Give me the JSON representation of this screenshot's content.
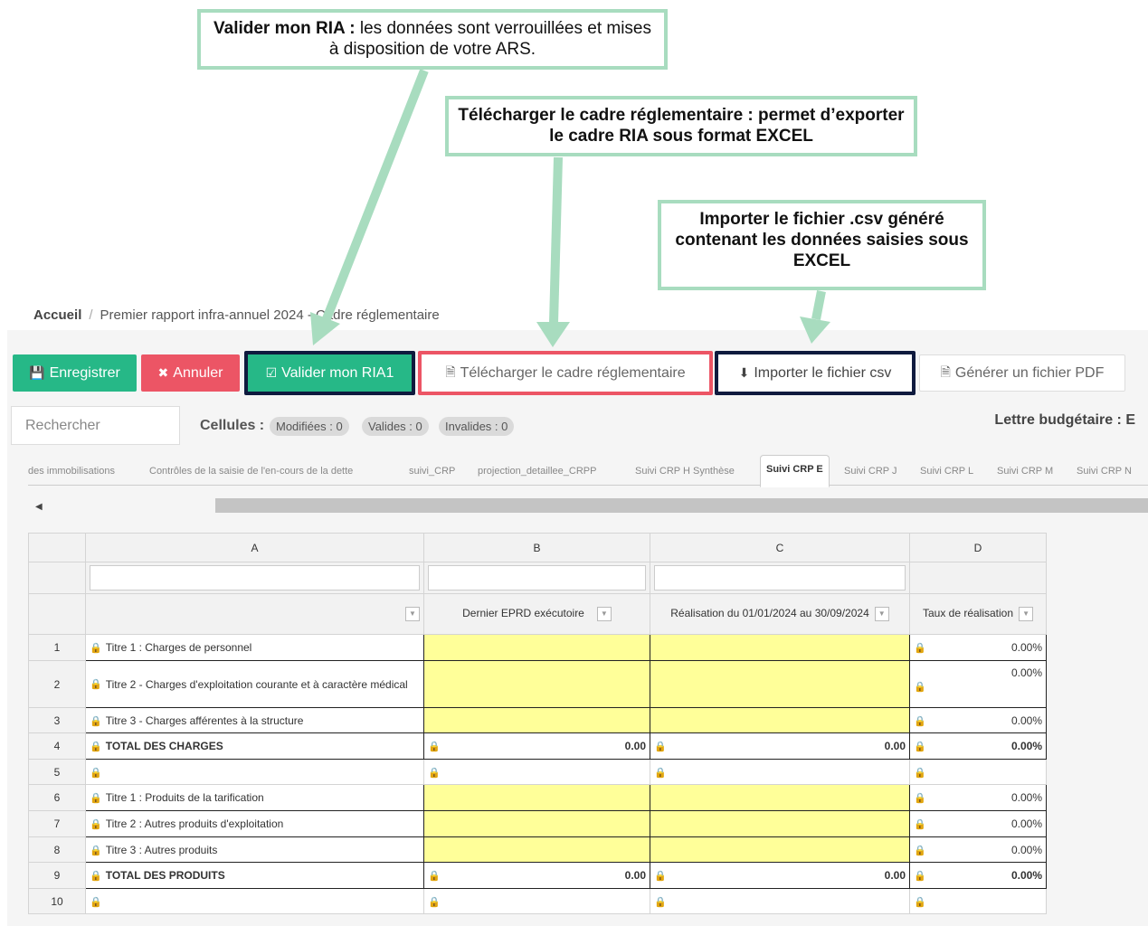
{
  "callouts": {
    "valider": {
      "bold": "Valider mon RIA :",
      "text": " les données sont verrouillées et mises à disposition de votre ARS."
    },
    "telecharger": "Télécharger le cadre réglementaire : permet d’exporter le cadre RIA sous format EXCEL",
    "importer": "Importer le fichier .csv généré contenant les données saisies sous EXCEL"
  },
  "breadcrumb": {
    "home": "Accueil",
    "separator": "/",
    "current": "Premier rapport infra-annuel 2024 - Cadre réglementaire"
  },
  "toolbar": {
    "save": "Enregistrer",
    "cancel": "Annuler",
    "validate": "Valider mon RIA1",
    "download": "Télécharger le cadre réglementaire",
    "import": "Importer le fichier csv",
    "pdf": "Générer un fichier PDF"
  },
  "search": {
    "placeholder": "Rechercher"
  },
  "cells": {
    "label": "Cellules :",
    "modified": "Modifiées : 0",
    "valid": "Valides : 0",
    "invalid": "Invalides : 0"
  },
  "lettre": "Lettre budgétaire : E",
  "tabs": [
    "des immobilisations",
    "Contrôles de la saisie de l'en-cours de la dette",
    "suivi_CRP",
    "projection_detaillee_CRPP",
    "Suivi CRP H Synthèse",
    "Suivi CRP E",
    "Suivi CRP J",
    "Suivi CRP L",
    "Suivi CRP M",
    "Suivi CRP N"
  ],
  "active_tab": "Suivi CRP E",
  "grid": {
    "columns": [
      "A",
      "B",
      "C",
      "D"
    ],
    "headers": [
      "",
      "Dernier EPRD exécutoire",
      "Réalisation du 01/01/2024 au 30/09/2024",
      "Taux de réalisation"
    ],
    "rows": [
      {
        "n": "1",
        "label": "Titre 1 : Charges de personnel",
        "b": "",
        "c": "",
        "d": "0.00%"
      },
      {
        "n": "2",
        "label": "Titre 2 - Charges d'exploitation courante et à caractère médical",
        "b": "",
        "c": "",
        "d": "0.00%"
      },
      {
        "n": "3",
        "label": "Titre 3 - Charges afférentes à la structure",
        "b": "",
        "c": "",
        "d": "0.00%"
      },
      {
        "n": "4",
        "label": "TOTAL DES CHARGES",
        "b": "0.00",
        "c": "0.00",
        "d": "0.00%"
      },
      {
        "n": "5",
        "label": "",
        "b": "",
        "c": "",
        "d": ""
      },
      {
        "n": "6",
        "label": "Titre 1 : Produits de la tarification",
        "b": "",
        "c": "",
        "d": "0.00%"
      },
      {
        "n": "7",
        "label": "Titre 2 : Autres produits d'exploitation",
        "b": "",
        "c": "",
        "d": "0.00%"
      },
      {
        "n": "8",
        "label": "Titre 3 : Autres produits",
        "b": "",
        "c": "",
        "d": "0.00%"
      },
      {
        "n": "9",
        "label": "TOTAL DES PRODUITS",
        "b": "0.00",
        "c": "0.00",
        "d": "0.00%"
      },
      {
        "n": "10",
        "label": "",
        "b": "",
        "c": "",
        "d": ""
      }
    ]
  }
}
